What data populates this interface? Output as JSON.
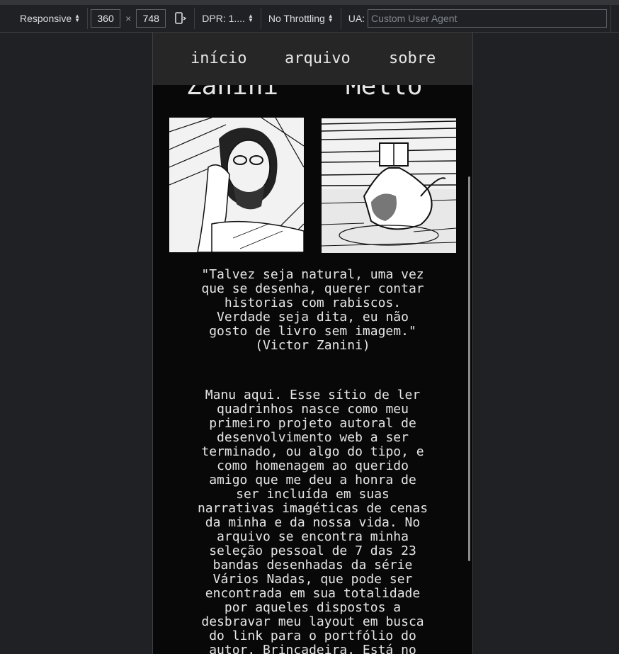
{
  "devtools": {
    "device_mode": "Responsive",
    "width": "360",
    "times": "×",
    "height": "748",
    "dpr": "DPR: 1....",
    "throttling": "No Throttling",
    "ua_label": "UA:",
    "ua_placeholder": "Custom User Agent"
  },
  "site": {
    "nav": [
      "início",
      "arquivo",
      "sobre"
    ],
    "names": [
      "Zanini",
      "Mello"
    ],
    "portraits": [
      "Victor Zanini portrait",
      "Manu Mello reading"
    ],
    "quote": "\"Talvez seja natural, uma vez\nque se desenha, querer contar\nhistorias com rabiscos.\nVerdade seja dita, eu não\ngosto de livro sem imagem.\"\n(Victor Zanini)",
    "about": "Manu aqui. Esse sítio de ler\nquadrinhos nasce como meu\nprimeiro projeto autoral de\ndesenvolvimento web a ser\nterminado, ou algo do tipo, e\ncomo homenagem ao querido\namigo que me deu a honra de\nser incluída em suas\nnarrativas imagéticas de cenas\nda minha e da nossa vida. No\narquivo se encontra minha\nseleção pessoal de 7 das 23\nbandas desenhadas da série\nVários Nadas, que pode ser\nencontrada em sua totalidade\npor aqueles dispostos a\ndesbravar meu layout em busca\ndo link para o portfólio do\nautor. Brincadeira. Está no"
  }
}
